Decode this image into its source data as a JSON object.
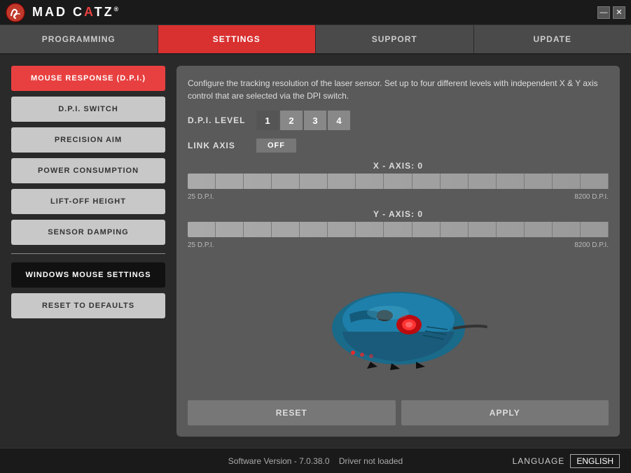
{
  "app": {
    "title": "MAD CATZ",
    "title_highlight": "®"
  },
  "titlebar": {
    "minimize_label": "—",
    "close_label": "✕"
  },
  "nav": {
    "tabs": [
      {
        "id": "programming",
        "label": "PROGRAMMING",
        "active": false
      },
      {
        "id": "settings",
        "label": "SETTINGS",
        "active": true
      },
      {
        "id": "support",
        "label": "SUPPORT",
        "active": false
      },
      {
        "id": "update",
        "label": "UPDATE",
        "active": false
      }
    ]
  },
  "left_menu": {
    "items": [
      {
        "id": "mouse-response",
        "label": "MOUSE RESPONSE (D.P.I.)",
        "active": true
      },
      {
        "id": "dpi-switch",
        "label": "D.P.I. SWITCH",
        "active": false
      },
      {
        "id": "precision-aim",
        "label": "PRECISION AIM",
        "active": false
      },
      {
        "id": "power-consumption",
        "label": "POWER CONSUMPTION",
        "active": false
      },
      {
        "id": "lift-off-height",
        "label": "LIFT-OFF HEIGHT",
        "active": false
      },
      {
        "id": "sensor-damping",
        "label": "SENSOR DAMPING",
        "active": false
      }
    ],
    "windows_settings": "WINDOWS MOUSE SETTINGS",
    "reset_defaults": "RESET TO DEFAULTS"
  },
  "right_panel": {
    "description": "Configure the tracking resolution of the laser sensor. Set up to four different levels with independent X & Y axis control that are selected via the DPI switch.",
    "dpi_level_label": "D.P.I. LEVEL",
    "link_axis_label": "LINK AXIS",
    "dpi_levels": [
      "1",
      "2",
      "3",
      "4"
    ],
    "active_dpi_level": 0,
    "link_axis_value": "OFF",
    "x_axis_label": "X - AXIS: 0",
    "y_axis_label": "Y - AXIS: 0",
    "slider_min": "25 D.P.I.",
    "slider_max": "8200 D.P.I.",
    "reset_btn": "RESET",
    "apply_btn": "APPLY"
  },
  "footer": {
    "version_text": "Software Version - 7.0.38.0",
    "driver_text": "Driver not loaded",
    "language_label": "LANGUAGE",
    "language_value": "ENGLISH"
  }
}
